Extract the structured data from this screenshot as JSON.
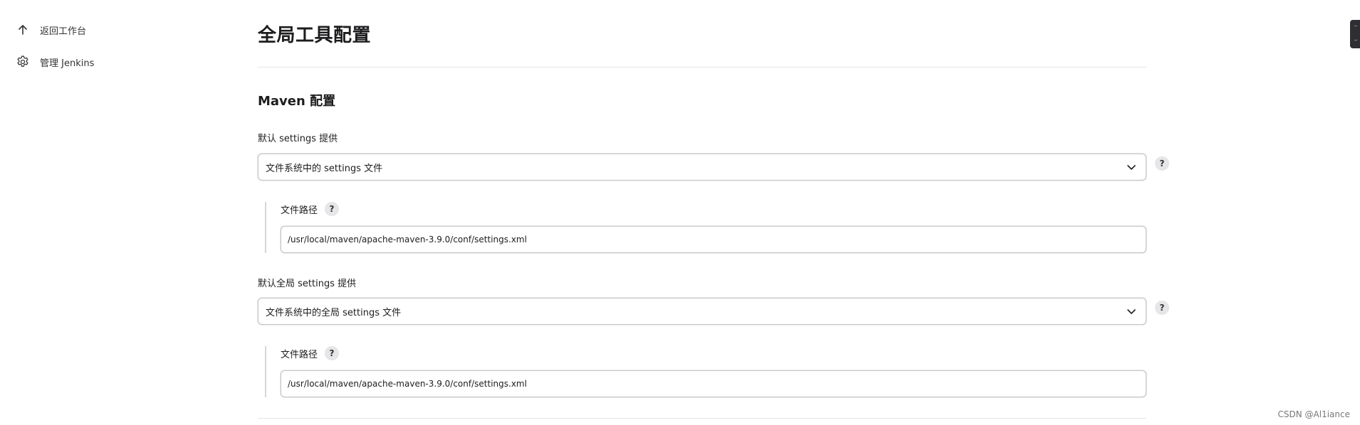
{
  "sidebar": {
    "items": [
      {
        "label": "返回工作台",
        "icon": "arrow-up-icon"
      },
      {
        "label": "管理 Jenkins",
        "icon": "gear-icon"
      }
    ]
  },
  "main": {
    "title": "全局工具配置",
    "section": {
      "title": "Maven 配置",
      "settings": {
        "label": "默认 settings 提供",
        "selected": "文件系统中的 settings 文件",
        "path_label": "文件路径",
        "path_value": "/usr/local/maven/apache-maven-3.9.0/conf/settings.xml"
      },
      "global_settings": {
        "label": "默认全局 settings 提供",
        "selected": "文件系统中的全局 settings 文件",
        "path_label": "文件路径",
        "path_value": "/usr/local/maven/apache-maven-3.9.0/conf/settings.xml"
      }
    },
    "help_symbol": "?"
  },
  "watermark": "CSDN @Al1iance"
}
